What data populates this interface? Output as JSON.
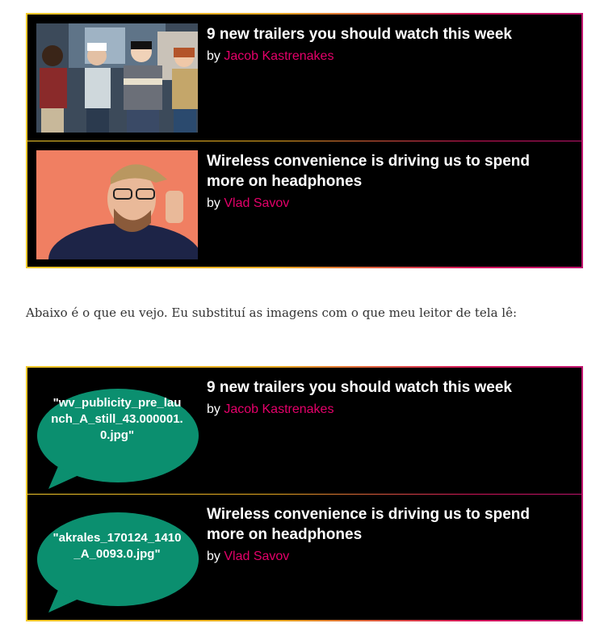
{
  "top_panel": {
    "articles": [
      {
        "title": "9 new trailers you should watch this week",
        "by": "by",
        "author": "Jacob Kastrenakes"
      },
      {
        "title": "Wireless convenience is driving us to spend more on headphones",
        "by": "by",
        "author": "Vlad Savov"
      }
    ]
  },
  "caption": "Abaixo é o que eu vejo. Eu substituí as imagens com o que meu leitor de tela lê:",
  "bottom_panel": {
    "articles": [
      {
        "title": "9 new trailers you should watch this week",
        "by": "by",
        "author": "Jacob Kastrenakes",
        "image_alt": "\"wv_publicity_pre_launch_A_still_43.000001.0.jpg\""
      },
      {
        "title": "Wireless convenience is driving us to spend more on headphones",
        "by": "by",
        "author": "Vlad Savov",
        "image_alt": "\"akrales_170124_1410_A_0093.0.jpg\""
      }
    ]
  },
  "colors": {
    "author_link": "#e5006a",
    "bubble": "#0b8f6f",
    "panel_bg": "#000000"
  }
}
